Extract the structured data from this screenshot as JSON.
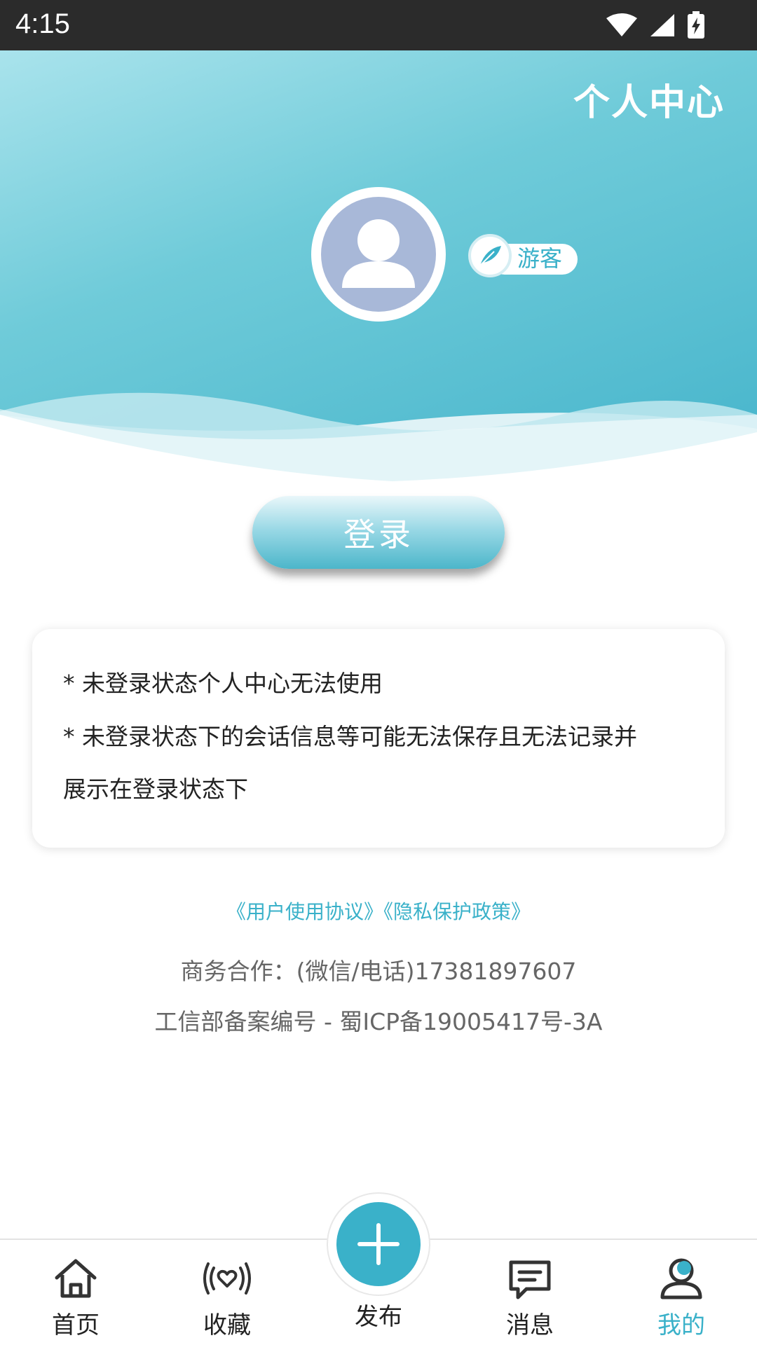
{
  "status_bar": {
    "time": "4:15",
    "icons": [
      "wifi-icon",
      "signal-icon",
      "battery-charging-icon"
    ]
  },
  "header": {
    "title": "个人中心",
    "avatar_icon": "user-avatar-icon",
    "role_badge": {
      "icon": "feather-icon",
      "label": "游客"
    }
  },
  "login_button": {
    "label": "登录"
  },
  "notice": {
    "line1": "* 未登录状态个人中心无法使用",
    "line2a": "* 未登录状态下的会话信息等可能无法保存且无法记录并",
    "line2b": "展示在登录状态下"
  },
  "links": {
    "user_agreement": "《用户使用协议》",
    "privacy_policy": "《隐私保护政策》"
  },
  "footer": {
    "contact": "商务合作：(微信/电话)17381897607",
    "icp": "工信部备案编号 - 蜀ICP备19005417号-3A"
  },
  "bottom_nav": {
    "home": {
      "label": "首页",
      "icon": "home-icon"
    },
    "favorites": {
      "label": "收藏",
      "icon": "broadcast-heart-icon"
    },
    "publish": {
      "label": "发布",
      "icon": "plus-icon"
    },
    "messages": {
      "label": "消息",
      "icon": "message-icon"
    },
    "mine": {
      "label": "我的",
      "icon": "profile-icon",
      "active": true
    }
  },
  "colors": {
    "accent": "#3ab1c9",
    "header_light": "#a9e3ec",
    "header_dark": "#45b4cb",
    "avatar_bg": "#a8b8d8",
    "status_bar": "#2b2b2b"
  }
}
